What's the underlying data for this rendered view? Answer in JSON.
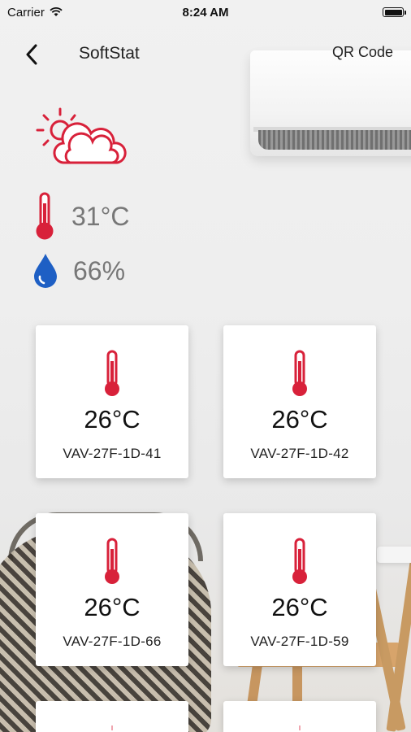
{
  "status_bar": {
    "carrier": "Carrier",
    "time": "8:24 AM"
  },
  "nav": {
    "title": "SoftStat",
    "qr_label": "QR Code"
  },
  "weather": {
    "icon": "sun-cloud-icon",
    "temperature": "31°C",
    "humidity": "66%"
  },
  "devices": [
    {
      "temp": "26°C",
      "name": "VAV-27F-1D-41"
    },
    {
      "temp": "26°C",
      "name": "VAV-27F-1D-42"
    },
    {
      "temp": "26°C",
      "name": "VAV-27F-1D-66"
    },
    {
      "temp": "26°C",
      "name": "VAV-27F-1D-59"
    }
  ],
  "colors": {
    "accent_red": "#d8213a",
    "humidity_blue": "#1e5fc4"
  }
}
